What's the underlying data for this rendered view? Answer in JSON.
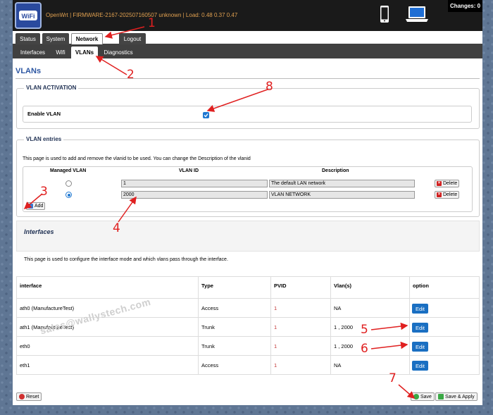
{
  "header": {
    "status_text": "OpenWrt | FIRMWARE-2167-202507160507 unknown | Load: 0.48 0.37 0.47",
    "changes_label": "Changes: 0",
    "logo_text": "WiFi"
  },
  "main_tabs": [
    {
      "label": "Status"
    },
    {
      "label": "System"
    },
    {
      "label": "Network",
      "active": true
    },
    {
      "label": "Logout"
    }
  ],
  "sub_tabs": [
    {
      "label": "Interfaces"
    },
    {
      "label": "Wifi"
    },
    {
      "label": "VLANs",
      "active": true
    },
    {
      "label": "Diagnostics"
    }
  ],
  "page_title": "VLANs",
  "vlan_activation": {
    "legend": "VLAN ACTIVATION",
    "enable_label": "Enable VLAN",
    "enabled": true
  },
  "vlan_entries": {
    "legend": "VLAN entries",
    "description": "This page is used to add and remove the vlanid to be used. You can change the Description of the vlanid",
    "headers": {
      "managed": "Managed VLAN",
      "vlan_id": "VLAN ID",
      "description": "Description"
    },
    "rows": [
      {
        "selected": false,
        "vlan_id": "1",
        "description": "The default LAN network",
        "delete_label": "Delete"
      },
      {
        "selected": true,
        "vlan_id": "2000",
        "description": "VLAN NETWORK",
        "delete_label": "Delete"
      }
    ],
    "add_label": "Add"
  },
  "interfaces": {
    "title": "Interfaces",
    "description": "This page is used to configure the interface mode and which vlans pass through the interface.",
    "headers": {
      "interface": "interface",
      "type": "Type",
      "pvid": "PVID",
      "vlans": "Vlan(s)",
      "option": "option"
    },
    "rows": [
      {
        "interface": "ath0 (ManufactureTest)",
        "type": "Access",
        "pvid": "1",
        "vlans": "NA",
        "edit_label": "Edit"
      },
      {
        "interface": "ath1 (ManufactureTest)",
        "type": "Trunk",
        "pvid": "1",
        "vlans": "1 , 2000",
        "edit_label": "Edit"
      },
      {
        "interface": "eth0",
        "type": "Trunk",
        "pvid": "1",
        "vlans": "1 , 2000",
        "edit_label": "Edit"
      },
      {
        "interface": "eth1",
        "type": "Access",
        "pvid": "1",
        "vlans": "NA",
        "edit_label": "Edit"
      }
    ]
  },
  "footer": {
    "reset_label": "Reset",
    "save_label": "Save",
    "save_apply_label": "Save & Apply"
  },
  "watermark": "sales@wallystech.com",
  "annotations": {
    "n1": "1",
    "n2": "2",
    "n3": "3",
    "n4": "4",
    "n5": "5",
    "n6": "6",
    "n7": "7",
    "n8": "8"
  },
  "colors": {
    "accent_blue": "#1a6fc2",
    "title_blue": "#2b55a1",
    "status_orange": "#e0a050",
    "annotation_red": "#e02020"
  }
}
